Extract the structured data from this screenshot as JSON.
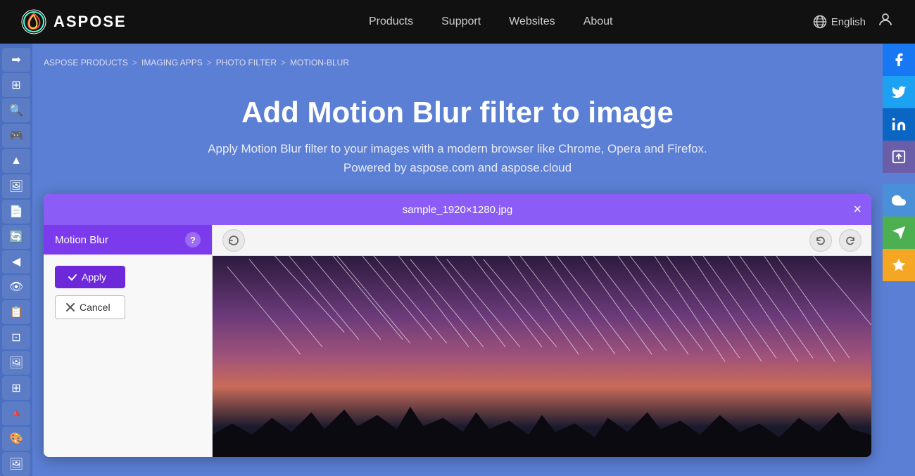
{
  "topnav": {
    "logo_text": "ASPOSE",
    "links": [
      {
        "label": "Products",
        "id": "products"
      },
      {
        "label": "Support",
        "id": "support"
      },
      {
        "label": "Websites",
        "id": "websites"
      },
      {
        "label": "About",
        "id": "about"
      }
    ],
    "language": "English",
    "lang_icon": "🌐"
  },
  "breadcrumb": {
    "items": [
      {
        "label": "ASPOSE PRODUCTS",
        "href": "#"
      },
      {
        "label": "IMAGING APPS",
        "href": "#"
      },
      {
        "label": "PHOTO FILTER",
        "href": "#"
      },
      {
        "label": "MOTION-BLUR",
        "href": "#"
      }
    ]
  },
  "hero": {
    "title": "Add Motion Blur filter to image",
    "description": "Apply Motion Blur filter to your images with a modern browser like Chrome, Opera and Firefox.",
    "powered_by": "Powered by aspose.com and aspose.cloud"
  },
  "filter_panel": {
    "title": "Motion Blur",
    "help_label": "?",
    "apply_label": "Apply",
    "cancel_label": "Cancel"
  },
  "viewer": {
    "filename": "sample_1920×1280.jpg",
    "close_label": "×"
  },
  "sidebar_icons": [
    "➡",
    "⊞",
    "🔍",
    "🎮",
    "🏔",
    "🖼",
    "🗒",
    "🔄",
    "◀",
    "👁",
    "📋",
    "🔲",
    "🖼",
    "⊡",
    "🔺",
    "🎨",
    "🖼"
  ],
  "social": [
    {
      "id": "facebook",
      "icon": "f",
      "class": "social-facebook"
    },
    {
      "id": "twitter",
      "icon": "🐦",
      "class": "social-twitter"
    },
    {
      "id": "linkedin",
      "icon": "in",
      "class": "social-linkedin"
    },
    {
      "id": "share",
      "icon": "🖼",
      "class": "social-share"
    },
    {
      "id": "cloud",
      "icon": "☁",
      "class": "social-cloud"
    },
    {
      "id": "announce",
      "icon": "📢",
      "class": "social-announce"
    },
    {
      "id": "star",
      "icon": "★",
      "class": "social-star"
    }
  ],
  "colors": {
    "purple_dark": "#7c3aed",
    "purple_bg": "#8b5cf6",
    "blue_bg": "#5b7fd4",
    "nav_bg": "#111111"
  }
}
